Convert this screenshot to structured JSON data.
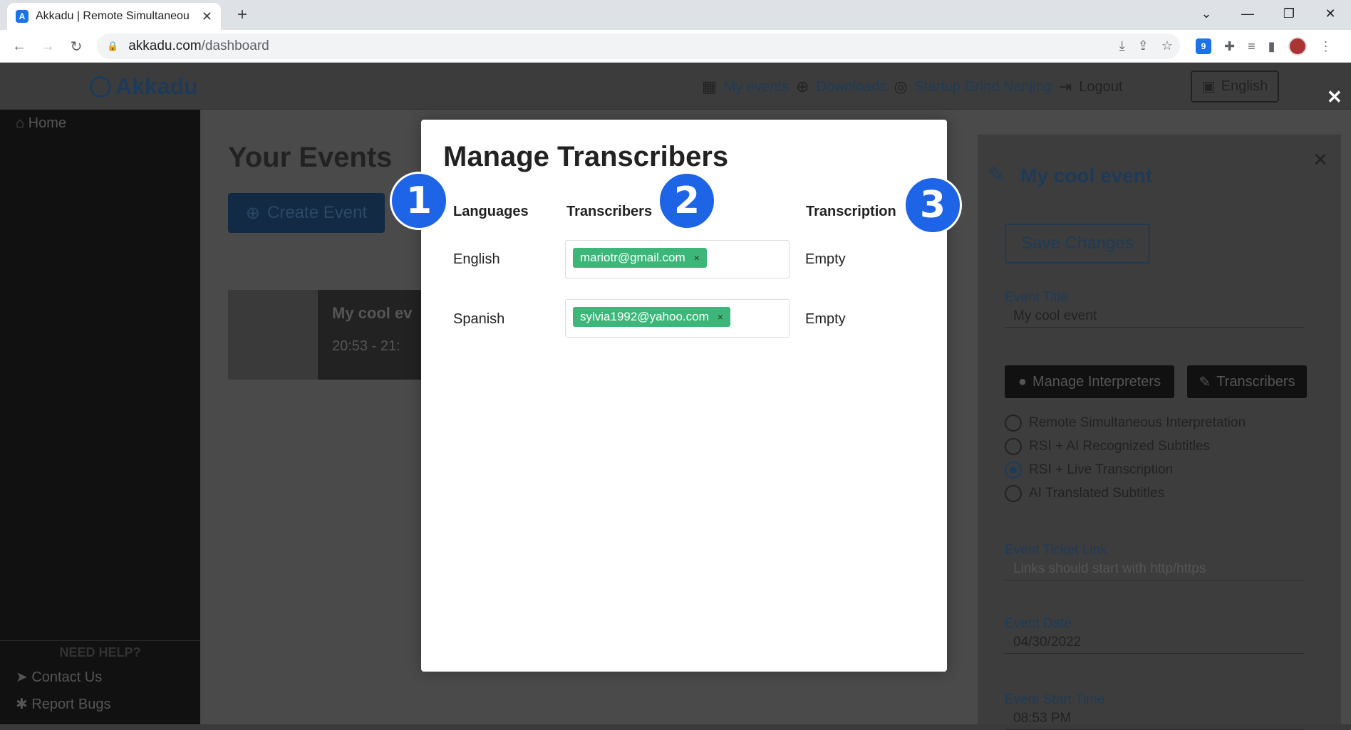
{
  "browser": {
    "tab_title": "Akkadu | Remote Simultaneou",
    "tab_close": "✕",
    "new_tab": "+",
    "url_domain": "akkadu.com",
    "url_path": "/dashboard",
    "ext_badge_count": "9"
  },
  "app": {
    "logo_text": "Akkadu",
    "nav": {
      "my_events": "My events",
      "downloads": "Downloads",
      "org": "Startup Grind Nanjing",
      "logout": "Logout",
      "language": "English"
    },
    "sidebar": {
      "home": "Home",
      "need_help": "NEED HELP?",
      "contact": "Contact Us",
      "report": "Report Bugs"
    },
    "main": {
      "title": "Your Events",
      "create_button": "Create Event",
      "event_card_title": "My cool ev",
      "event_card_time": "20:53 - 21:"
    },
    "right_panel": {
      "title": "My cool event",
      "save_button": "Save Changes",
      "event_title_label": "Event Title",
      "event_title_value": "My cool event",
      "manage_interpreters": "Manage Interpreters",
      "transcribers": "Transcribers",
      "modes": [
        "Remote Simultaneous Interpretation",
        "RSI + AI Recognized Subtitles",
        "RSI + Live Transcription",
        "AI Translated Subtitles"
      ],
      "selected_mode_index": 2,
      "ticket_link_label": "Event Ticket Link",
      "ticket_link_placeholder": "Links should start with http/https",
      "event_date_label": "Event Date",
      "event_date_value": "04/30/2022",
      "start_time_label": "Event Start Time",
      "start_time_value": "08:53 PM"
    }
  },
  "modal": {
    "title": "Manage Transcribers",
    "headers": {
      "languages": "Languages",
      "transcribers": "Transcribers",
      "transcription": "Transcription"
    },
    "rows": [
      {
        "language": "English",
        "transcriber": "mariotr@gmail.com",
        "transcription": "Empty"
      },
      {
        "language": "Spanish",
        "transcriber": "sylvia1992@yahoo.com",
        "transcription": "Empty"
      }
    ],
    "chip_remove": "×"
  },
  "badges": [
    "1",
    "2",
    "3"
  ],
  "overlay_close": "✕",
  "colors": {
    "chip": "#3db779",
    "badge": "#1e64e6",
    "brand": "#1d3b58"
  }
}
